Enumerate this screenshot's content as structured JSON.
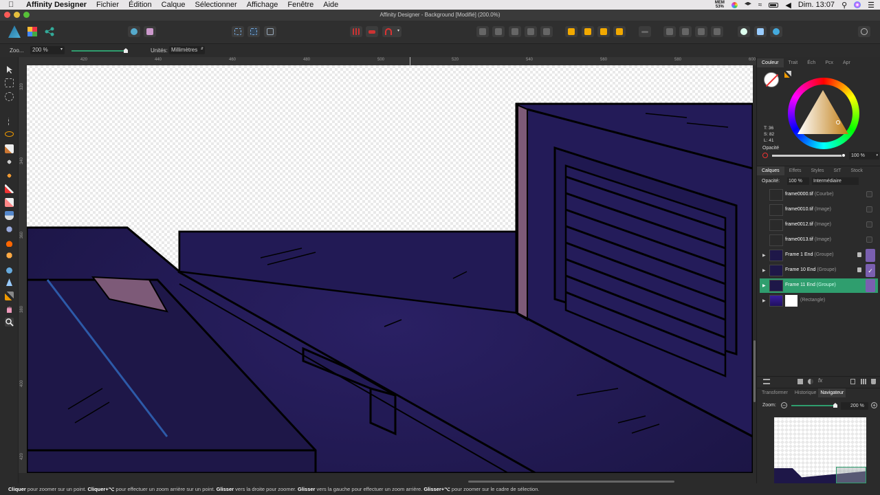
{
  "menubar": {
    "app_name": "Affinity Designer",
    "menus": [
      "Fichier",
      "Édition",
      "Calque",
      "Sélectionner",
      "Affichage",
      "Fenêtre",
      "Aide"
    ],
    "mem_label": "MEM",
    "mem_value": "53%",
    "clock": "Dim. 13:07"
  },
  "window": {
    "title": "Affinity Designer - Background [Modifié] (200.0%)"
  },
  "context": {
    "zoom_label": "Zoo...",
    "zoom_value": "200 %",
    "units_label": "Unités:",
    "units_value": "Millimètres"
  },
  "ruler": {
    "h_ticks": [
      "420",
      "440",
      "460",
      "480",
      "500",
      "520",
      "540",
      "560",
      "580",
      "600"
    ],
    "v_ticks": [
      "320",
      "340",
      "360",
      "380",
      "400",
      "420"
    ]
  },
  "color_panel": {
    "tabs": [
      "Couleur",
      "Trait",
      "Éch",
      "Pcx",
      "Apr"
    ],
    "active_tab": "Couleur",
    "hsl_t": "T: 36",
    "hsl_s": "S: 82",
    "hsl_l": "L: 41",
    "opacity_label": "Opacité",
    "opacity_value": "100 %"
  },
  "layers_panel": {
    "tabs": [
      "Calques",
      "Effets",
      "Styles",
      "StT",
      "Stock"
    ],
    "active_tab": "Calques",
    "opacity_label": "Opacité:",
    "opacity_value": "100 %",
    "blend_mode": "Intermédiaire",
    "layers": [
      {
        "name": "frame0000.tif",
        "type": "(Courbe)"
      },
      {
        "name": "frame0010.tif",
        "type": "(Image)"
      },
      {
        "name": "frame0012.tif",
        "type": "(Image)"
      },
      {
        "name": "frame0013.tif",
        "type": "(Image)"
      },
      {
        "name": "Frame 1 End",
        "type": "(Groupe)"
      },
      {
        "name": "Frame 10 End",
        "type": "(Groupe)"
      },
      {
        "name": "Frame 11 End",
        "type": "(Groupe)"
      },
      {
        "name": "",
        "type": "(Rectangle)"
      }
    ]
  },
  "nav_panel": {
    "tabs": [
      "Transformer",
      "Historique",
      "Navigateur"
    ],
    "active_tab": "Navigateur",
    "zoom_label": "Zoom:",
    "zoom_value": "200 %"
  },
  "statusbar": {
    "parts": [
      {
        "b": "Cliquer",
        "t": " pour zoomer sur un point. "
      },
      {
        "b": "Cliquer+⌥",
        "t": " pour effectuer un zoom arrière sur un point. "
      },
      {
        "b": "Glisser",
        "t": " vers la droite pour zoomer. "
      },
      {
        "b": "Glisser",
        "t": " vers la gauche pour effectuer un zoom arrière. "
      },
      {
        "b": "Glisser+⌥",
        "t": " pour zoomer sur le cadre de sélection."
      }
    ]
  },
  "colors": {
    "accent": "#2f9e6e",
    "scene_dark": "#1d1747",
    "scene_mid": "#241c5a",
    "rust": "#7d5a78"
  }
}
